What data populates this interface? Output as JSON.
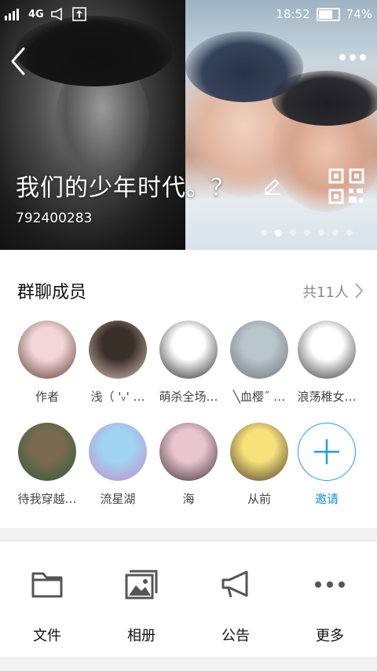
{
  "status_bar": {
    "network": "4G",
    "time": "18:52",
    "battery": "74%"
  },
  "header": {
    "group_name": "我们的少年时代。？",
    "group_id": "792400283",
    "carousel_dot_count": 7,
    "carousel_active_index": 1
  },
  "members": {
    "title": "群聊成员",
    "count_label": "共11人",
    "list": [
      {
        "name": "作者",
        "colors": [
          "#f3d6d8",
          "#5a3b2e"
        ]
      },
      {
        "name": "浅（ 'ᵥ' …",
        "colors": [
          "#3b2f2a",
          "#d7c2b0"
        ]
      },
      {
        "name": "萌杀全场…",
        "colors": [
          "#ffffff",
          "#222222"
        ]
      },
      {
        "name": "╲血樱˝ …",
        "colors": [
          "#b9c6cc",
          "#6d7478"
        ]
      },
      {
        "name": "浪荡稚女…",
        "colors": [
          "#ffffff",
          "#333333"
        ]
      },
      {
        "name": "待我穿越…",
        "colors": [
          "#7a6a4f",
          "#2e5c3b"
        ]
      },
      {
        "name": "流星湖",
        "colors": [
          "#9fd4f2",
          "#c58ac9"
        ]
      },
      {
        "name": "海",
        "colors": [
          "#e9c6cf",
          "#3d2d37"
        ]
      },
      {
        "name": "从前",
        "colors": [
          "#f7e27a",
          "#4a3a2a"
        ]
      }
    ],
    "invite_label": "邀请"
  },
  "actions": [
    {
      "label": "文件",
      "icon": "folder-icon"
    },
    {
      "label": "相册",
      "icon": "album-icon"
    },
    {
      "label": "公告",
      "icon": "megaphone-icon"
    },
    {
      "label": "更多",
      "icon": "more-icon"
    }
  ]
}
